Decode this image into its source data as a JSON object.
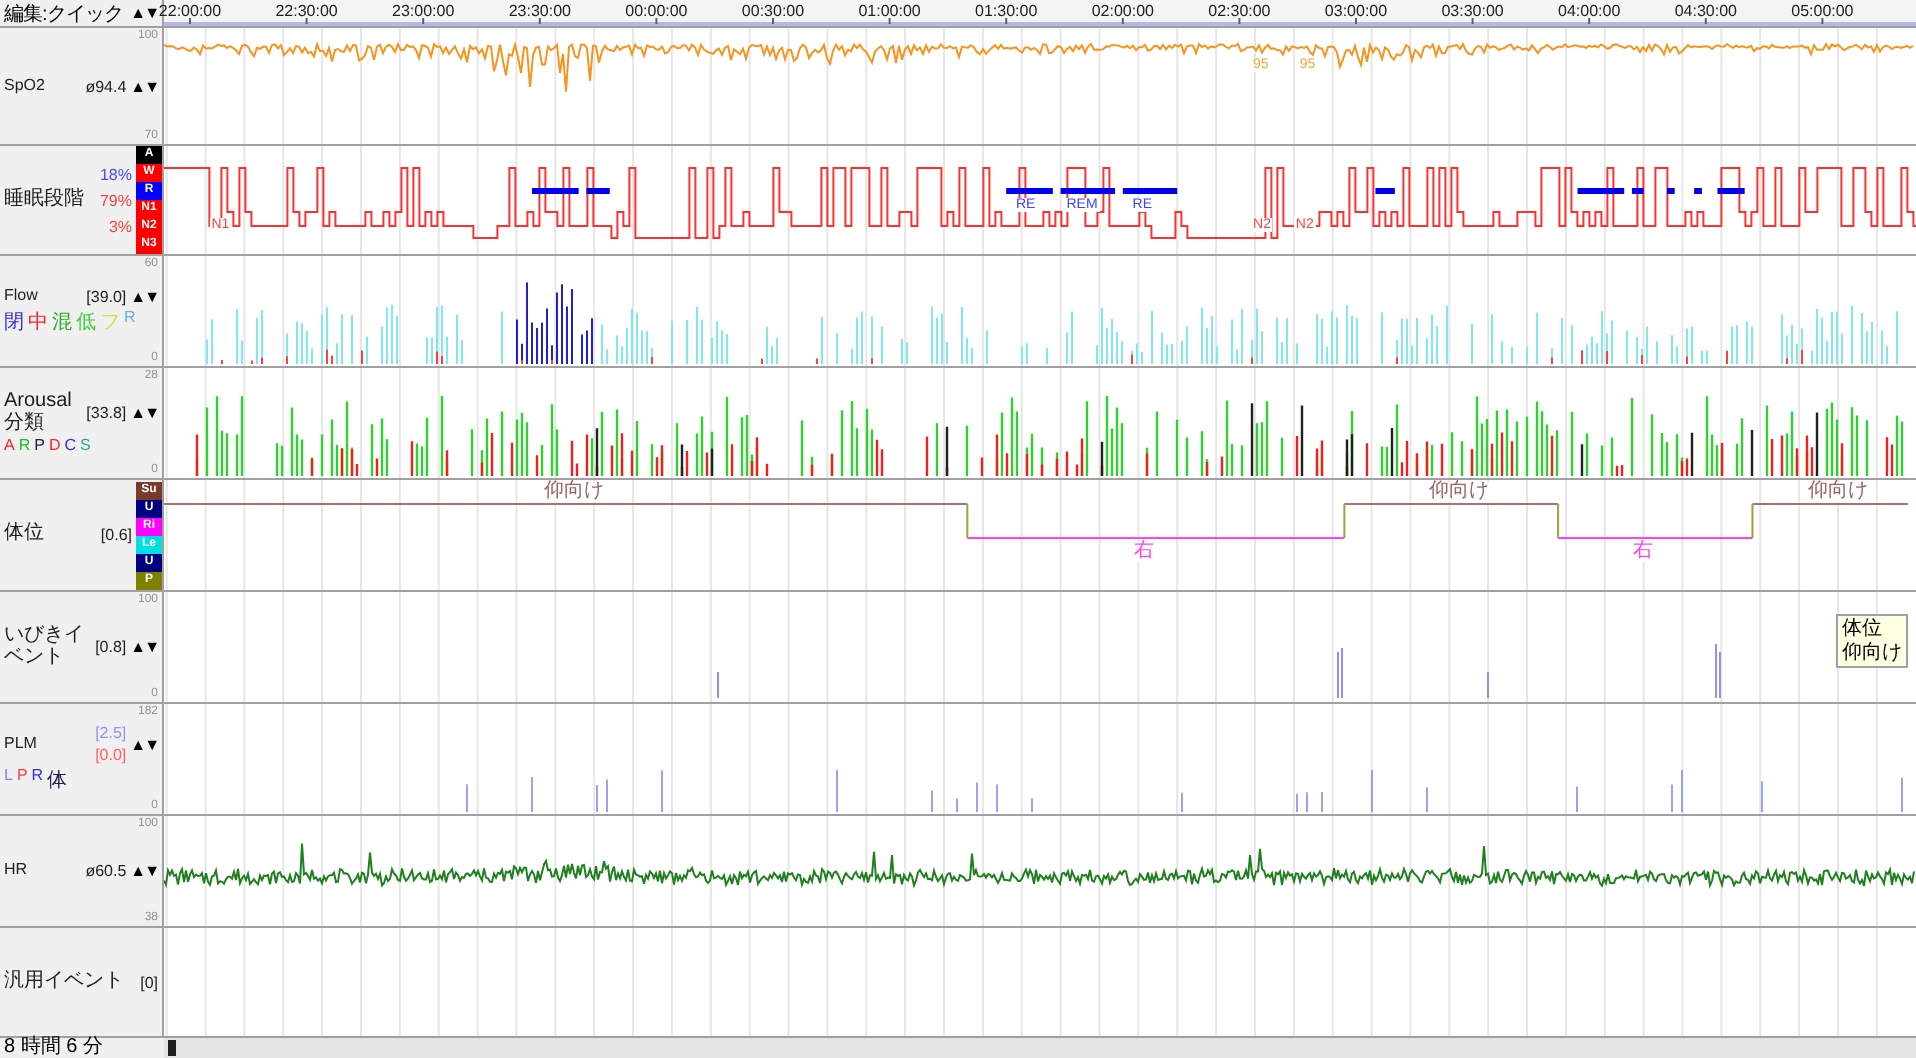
{
  "header": {
    "title": "編集:クイック",
    "arrows": "▲▼"
  },
  "time_axis": {
    "ticks": [
      "22:00:00",
      "22:30:00",
      "23:00:00",
      "23:30:00",
      "00:00:00",
      "00:30:00",
      "01:00:00",
      "01:30:00",
      "02:00:00",
      "02:30:00",
      "03:00:00",
      "03:30:00",
      "04:00:00",
      "04:30:00",
      "05:00:00"
    ]
  },
  "channels": [
    {
      "kind": "spo2",
      "name": "SpO2",
      "value": "ø94.4",
      "arrows": "▲▼",
      "scale_max": "100",
      "scale_min": "70",
      "annotations": [
        {
          "text": "95"
        },
        {
          "text": "95"
        }
      ]
    },
    {
      "kind": "stage",
      "name": "睡眠段階",
      "stats": [
        {
          "text": "18%",
          "color": "#4a4aff"
        },
        {
          "text": "79%",
          "color": "#ff4040"
        },
        {
          "text": "3%",
          "color": "#ff4040"
        }
      ],
      "legend": [
        {
          "text": "A",
          "color": "#000000"
        },
        {
          "text": "W",
          "color": "#ff0000"
        },
        {
          "text": "R",
          "color": "#0000ff"
        },
        {
          "text": "N1",
          "color": "#ff0000"
        },
        {
          "text": "N2",
          "color": "#ff0000"
        },
        {
          "text": "N3",
          "color": "#ff0000"
        }
      ],
      "annotations": [
        {
          "text": "N1",
          "kind": "nrem"
        },
        {
          "text": "RE",
          "kind": "rem"
        },
        {
          "text": "REM",
          "kind": "rem"
        },
        {
          "text": "RE",
          "kind": "rem"
        },
        {
          "text": "N2",
          "kind": "nrem"
        },
        {
          "text": "N2",
          "kind": "nrem"
        }
      ]
    },
    {
      "kind": "flow",
      "name": "Flow",
      "value": "[39.0]",
      "arrows": "▲▼",
      "scale_max": "60",
      "scale_min": "0",
      "legend": [
        {
          "text": "閉",
          "color": "#3030d0"
        },
        {
          "text": "中",
          "color": "#ff2020"
        },
        {
          "text": "混",
          "color": "#20b020"
        },
        {
          "text": "低",
          "color": "#40d040"
        },
        {
          "text": "フ",
          "color": "#d8d840"
        },
        {
          "text": "R",
          "color": "#60b0e0"
        }
      ]
    },
    {
      "kind": "arousal",
      "name": "Arousal分類",
      "value": "[33.8]",
      "arrows": "▲▼",
      "scale_max": "28",
      "scale_min": "0",
      "legend": [
        {
          "text": "A",
          "color": "#ff2020"
        },
        {
          "text": "R",
          "color": "#20c020"
        },
        {
          "text": "P",
          "color": "#202050"
        },
        {
          "text": "D",
          "color": "#ff2020"
        },
        {
          "text": "C",
          "color": "#3030e0"
        },
        {
          "text": "S",
          "color": "#30a0a0"
        }
      ]
    },
    {
      "kind": "position",
      "name": "体位",
      "value": "[0.6]",
      "legend": [
        {
          "text": "Su",
          "color": "#7a3a2a"
        },
        {
          "text": "U",
          "color": "#000080"
        },
        {
          "text": "Ri",
          "color": "#ff00ff"
        },
        {
          "text": "Le",
          "color": "#00e0e0"
        },
        {
          "text": "U",
          "color": "#000080"
        },
        {
          "text": "P",
          "color": "#808000"
        }
      ],
      "segments": [
        {
          "kind": "supine",
          "label": "仰向け"
        },
        {
          "kind": "right",
          "label": "右"
        },
        {
          "kind": "supine",
          "label": "仰向け"
        },
        {
          "kind": "right",
          "label": "右"
        },
        {
          "kind": "supine",
          "label": "仰向け"
        }
      ]
    },
    {
      "kind": "snore",
      "name": "いびきイベント",
      "value": "[0.8]",
      "arrows": "▲▼",
      "scale_max": "100",
      "scale_min": "0"
    },
    {
      "kind": "plm",
      "name": "PLM",
      "values": [
        {
          "text": "[2.5]",
          "color": "#9090ff"
        },
        {
          "text": "[0.0]",
          "color": "#ff6060"
        }
      ],
      "arrows": "▲▼",
      "scale_max": "182",
      "scale_min": "0",
      "legend": [
        {
          "text": "L",
          "color": "#8080ff"
        },
        {
          "text": "P",
          "color": "#ff4040"
        },
        {
          "text": "R",
          "color": "#3030e0"
        },
        {
          "text": "体",
          "color": "#202050"
        }
      ]
    },
    {
      "kind": "hr",
      "name": "HR",
      "value": "ø60.5",
      "arrows": "▲▼",
      "scale_max": "100",
      "scale_min": "38"
    },
    {
      "kind": "general",
      "name": "汎用イベント",
      "value": "[0]"
    }
  ],
  "tooltip": {
    "title": "体位",
    "text": "仰向け"
  },
  "footer": {
    "duration": "8 時間 6 分"
  }
}
